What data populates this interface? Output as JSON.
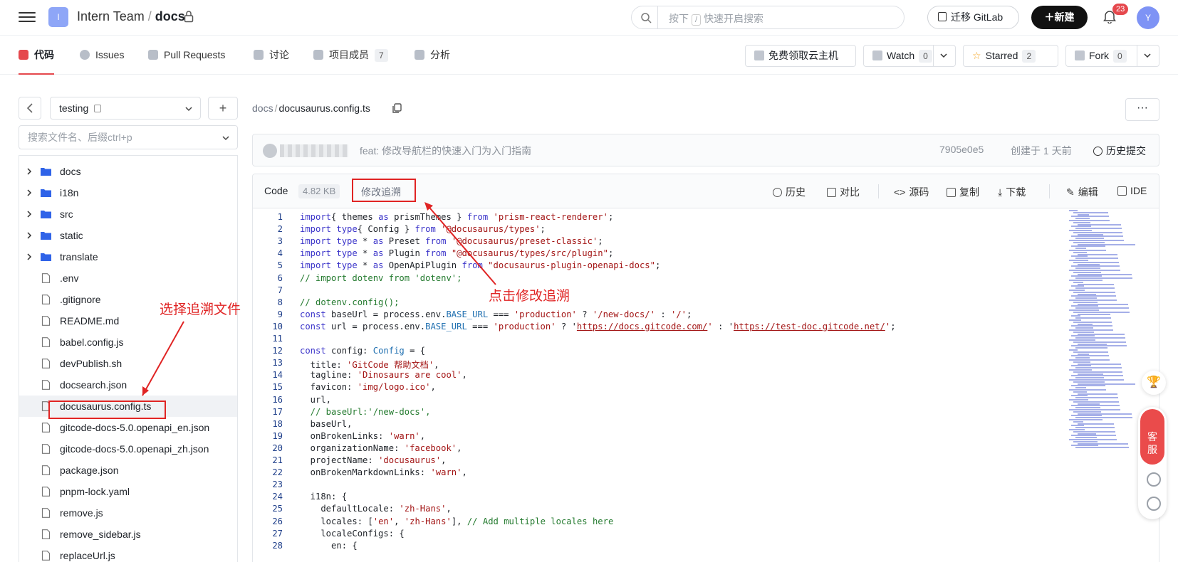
{
  "header": {
    "repo_icon_letter": "I",
    "org": "Intern Team",
    "separator": "/",
    "repo": "docs",
    "search_placeholder_prefix": "按下",
    "search_key": "/",
    "search_placeholder_suffix": "快速开启搜索",
    "migrate_label": "迁移 GitLab",
    "new_label": "新建",
    "notifications": "23",
    "avatar_letter": "Y"
  },
  "nav": {
    "tabs": [
      {
        "label": "代码",
        "count": ""
      },
      {
        "label": "Issues",
        "count": ""
      },
      {
        "label": "Pull Requests",
        "count": ""
      },
      {
        "label": "讨论",
        "count": ""
      },
      {
        "label": "项目成员",
        "count": "7"
      },
      {
        "label": "分析",
        "count": ""
      }
    ],
    "cloud_label": "免费领取云主机",
    "watch_label": "Watch",
    "watch_count": "0",
    "starred_label": "Starred",
    "starred_count": "2",
    "fork_label": "Fork",
    "fork_count": "0"
  },
  "sidebar": {
    "branch": "testing",
    "file_search_placeholder": "搜索文件名、后缀ctrl+p",
    "items": [
      {
        "name": "docs",
        "type": "folder"
      },
      {
        "name": "i18n",
        "type": "folder"
      },
      {
        "name": "src",
        "type": "folder"
      },
      {
        "name": "static",
        "type": "folder"
      },
      {
        "name": "translate",
        "type": "folder"
      },
      {
        "name": ".env",
        "type": "file"
      },
      {
        "name": ".gitignore",
        "type": "file"
      },
      {
        "name": "README.md",
        "type": "file"
      },
      {
        "name": "babel.config.js",
        "type": "file"
      },
      {
        "name": "devPublish.sh",
        "type": "file"
      },
      {
        "name": "docsearch.json",
        "type": "file"
      },
      {
        "name": "docusaurus.config.ts",
        "type": "file"
      },
      {
        "name": "gitcode-docs-5.0.openapi_en.json",
        "type": "file"
      },
      {
        "name": "gitcode-docs-5.0.openapi_zh.json",
        "type": "file"
      },
      {
        "name": "package.json",
        "type": "file"
      },
      {
        "name": "pnpm-lock.yaml",
        "type": "file"
      },
      {
        "name": "remove.js",
        "type": "file"
      },
      {
        "name": "remove_sidebar.js",
        "type": "file"
      },
      {
        "name": "replaceUrl.js",
        "type": "file"
      }
    ],
    "selected_index": 11
  },
  "file": {
    "path_dir": "docs",
    "path_sep": "/",
    "path_file": "docusaurus.config.ts",
    "more_label": "···"
  },
  "commit": {
    "message": "feat: 修改导航栏的快速入门为入门指南",
    "sha": "7905e0e5",
    "date": "创建于 1 天前",
    "history_label": "历史提交"
  },
  "code_header": {
    "code_label": "Code",
    "size": "4.82 KB",
    "trace_label": "修改追溯",
    "tools": [
      "历史",
      "对比",
      "源码",
      "复制",
      "下载",
      "编辑",
      "IDE"
    ]
  },
  "code_lines": [
    [
      [
        "kw",
        "import"
      ],
      [
        "",
        "{ themes "
      ],
      [
        "kw",
        "as"
      ],
      [
        "",
        " prismThemes } "
      ],
      [
        "kw",
        "from"
      ],
      [
        "",
        ""
      ],
      [
        "st",
        " 'prism-react-renderer'"
      ],
      [
        "",
        ";"
      ]
    ],
    [
      [
        "kw",
        "import type"
      ],
      [
        "",
        ""
      ],
      [
        "",
        "{ Config } "
      ],
      [
        "kw",
        "from"
      ],
      [
        "st",
        " '@docusaurus/types'"
      ],
      [
        "",
        ";"
      ]
    ],
    [
      [
        "kw",
        "import type"
      ],
      [
        "",
        " * "
      ],
      [
        "kw",
        "as"
      ],
      [
        "",
        " Preset "
      ],
      [
        "kw",
        "from"
      ],
      [
        "st",
        " '@docusaurus/preset-classic'"
      ],
      [
        "",
        ";"
      ]
    ],
    [
      [
        "kw",
        "import type"
      ],
      [
        "",
        " * "
      ],
      [
        "kw",
        "as"
      ],
      [
        "",
        " Plugin "
      ],
      [
        "kw",
        "from"
      ],
      [
        "st",
        " \"@docusaurus/types/src/plugin\""
      ],
      [
        "",
        ";"
      ]
    ],
    [
      [
        "kw",
        "import type"
      ],
      [
        "",
        " * "
      ],
      [
        "kw",
        "as"
      ],
      [
        "",
        " OpenApiPlugin "
      ],
      [
        "kw",
        "from"
      ],
      [
        "st",
        " \"docusaurus-plugin-openapi-docs\""
      ],
      [
        "",
        ";"
      ]
    ],
    [
      [
        "cm",
        "// import dotenv from 'dotenv';"
      ]
    ],
    [
      [
        "",
        ""
      ]
    ],
    [
      [
        "cm",
        "// dotenv.config();"
      ]
    ],
    [
      [
        "kw",
        "const"
      ],
      [
        "",
        " baseUrl = process.env."
      ],
      [
        "ty",
        "BASE_URL"
      ],
      [
        "",
        " === "
      ],
      [
        "st",
        "'production'"
      ],
      [
        "",
        " ? "
      ],
      [
        "st",
        "'/new-docs/'"
      ],
      [
        "",
        " : "
      ],
      [
        "st",
        "'/'"
      ],
      [
        "",
        ";"
      ]
    ],
    [
      [
        "kw",
        "const"
      ],
      [
        "",
        " url = process.env."
      ],
      [
        "ty",
        "BASE_URL"
      ],
      [
        "",
        " === "
      ],
      [
        "st",
        "'production'"
      ],
      [
        "",
        " ? '"
      ],
      [
        "stu",
        "https://docs.gitcode.com/"
      ],
      [
        "st",
        "'"
      ],
      [
        "",
        " : '"
      ],
      [
        "stu",
        "https://test-doc.gitcode.net/"
      ],
      [
        "st",
        "'"
      ],
      [
        "",
        ";"
      ]
    ],
    [
      [
        "",
        ""
      ]
    ],
    [
      [
        "kw",
        "const"
      ],
      [
        "",
        " config: "
      ],
      [
        "ty",
        "Config"
      ],
      [
        "",
        " = {"
      ]
    ],
    [
      [
        "",
        "  title: "
      ],
      [
        "st",
        "'GitCode 帮助文档'"
      ],
      [
        "",
        ","
      ]
    ],
    [
      [
        "",
        "  tagline: "
      ],
      [
        "st",
        "'Dinosaurs are cool'"
      ],
      [
        "",
        ","
      ]
    ],
    [
      [
        "",
        "  favicon: "
      ],
      [
        "st",
        "'img/logo.ico'"
      ],
      [
        "",
        ","
      ]
    ],
    [
      [
        "",
        "  url,"
      ]
    ],
    [
      [
        "cm",
        "  // baseUrl:'/new-docs',"
      ]
    ],
    [
      [
        "",
        "  baseUrl,"
      ]
    ],
    [
      [
        "",
        "  onBrokenLinks: "
      ],
      [
        "st",
        "'warn'"
      ],
      [
        "",
        ","
      ]
    ],
    [
      [
        "",
        "  organizationName: "
      ],
      [
        "st",
        "'facebook'"
      ],
      [
        "",
        ","
      ]
    ],
    [
      [
        "",
        "  projectName: "
      ],
      [
        "st",
        "'docusaurus'"
      ],
      [
        "",
        ","
      ]
    ],
    [
      [
        "",
        "  onBrokenMarkdownLinks: "
      ],
      [
        "st",
        "'warn'"
      ],
      [
        "",
        ","
      ]
    ],
    [
      [
        "",
        ""
      ]
    ],
    [
      [
        "",
        "  i18n: {"
      ]
    ],
    [
      [
        "",
        "    defaultLocale: "
      ],
      [
        "st",
        "'zh-Hans'"
      ],
      [
        "",
        ","
      ]
    ],
    [
      [
        "",
        "    locales: ["
      ],
      [
        "st",
        "'en'"
      ],
      [
        "",
        ", "
      ],
      [
        "st",
        "'zh-Hans'"
      ],
      [
        "",
        "], "
      ],
      [
        "cm",
        "// Add multiple locales here"
      ]
    ],
    [
      [
        "",
        "    localeConfigs: {"
      ]
    ],
    [
      [
        "",
        "      en: {"
      ]
    ]
  ],
  "float": {
    "kefu_line1": "客",
    "kefu_line2": "服"
  },
  "annotations": {
    "select_file": "选择追溯文件",
    "click_trace": "点击修改追溯"
  }
}
